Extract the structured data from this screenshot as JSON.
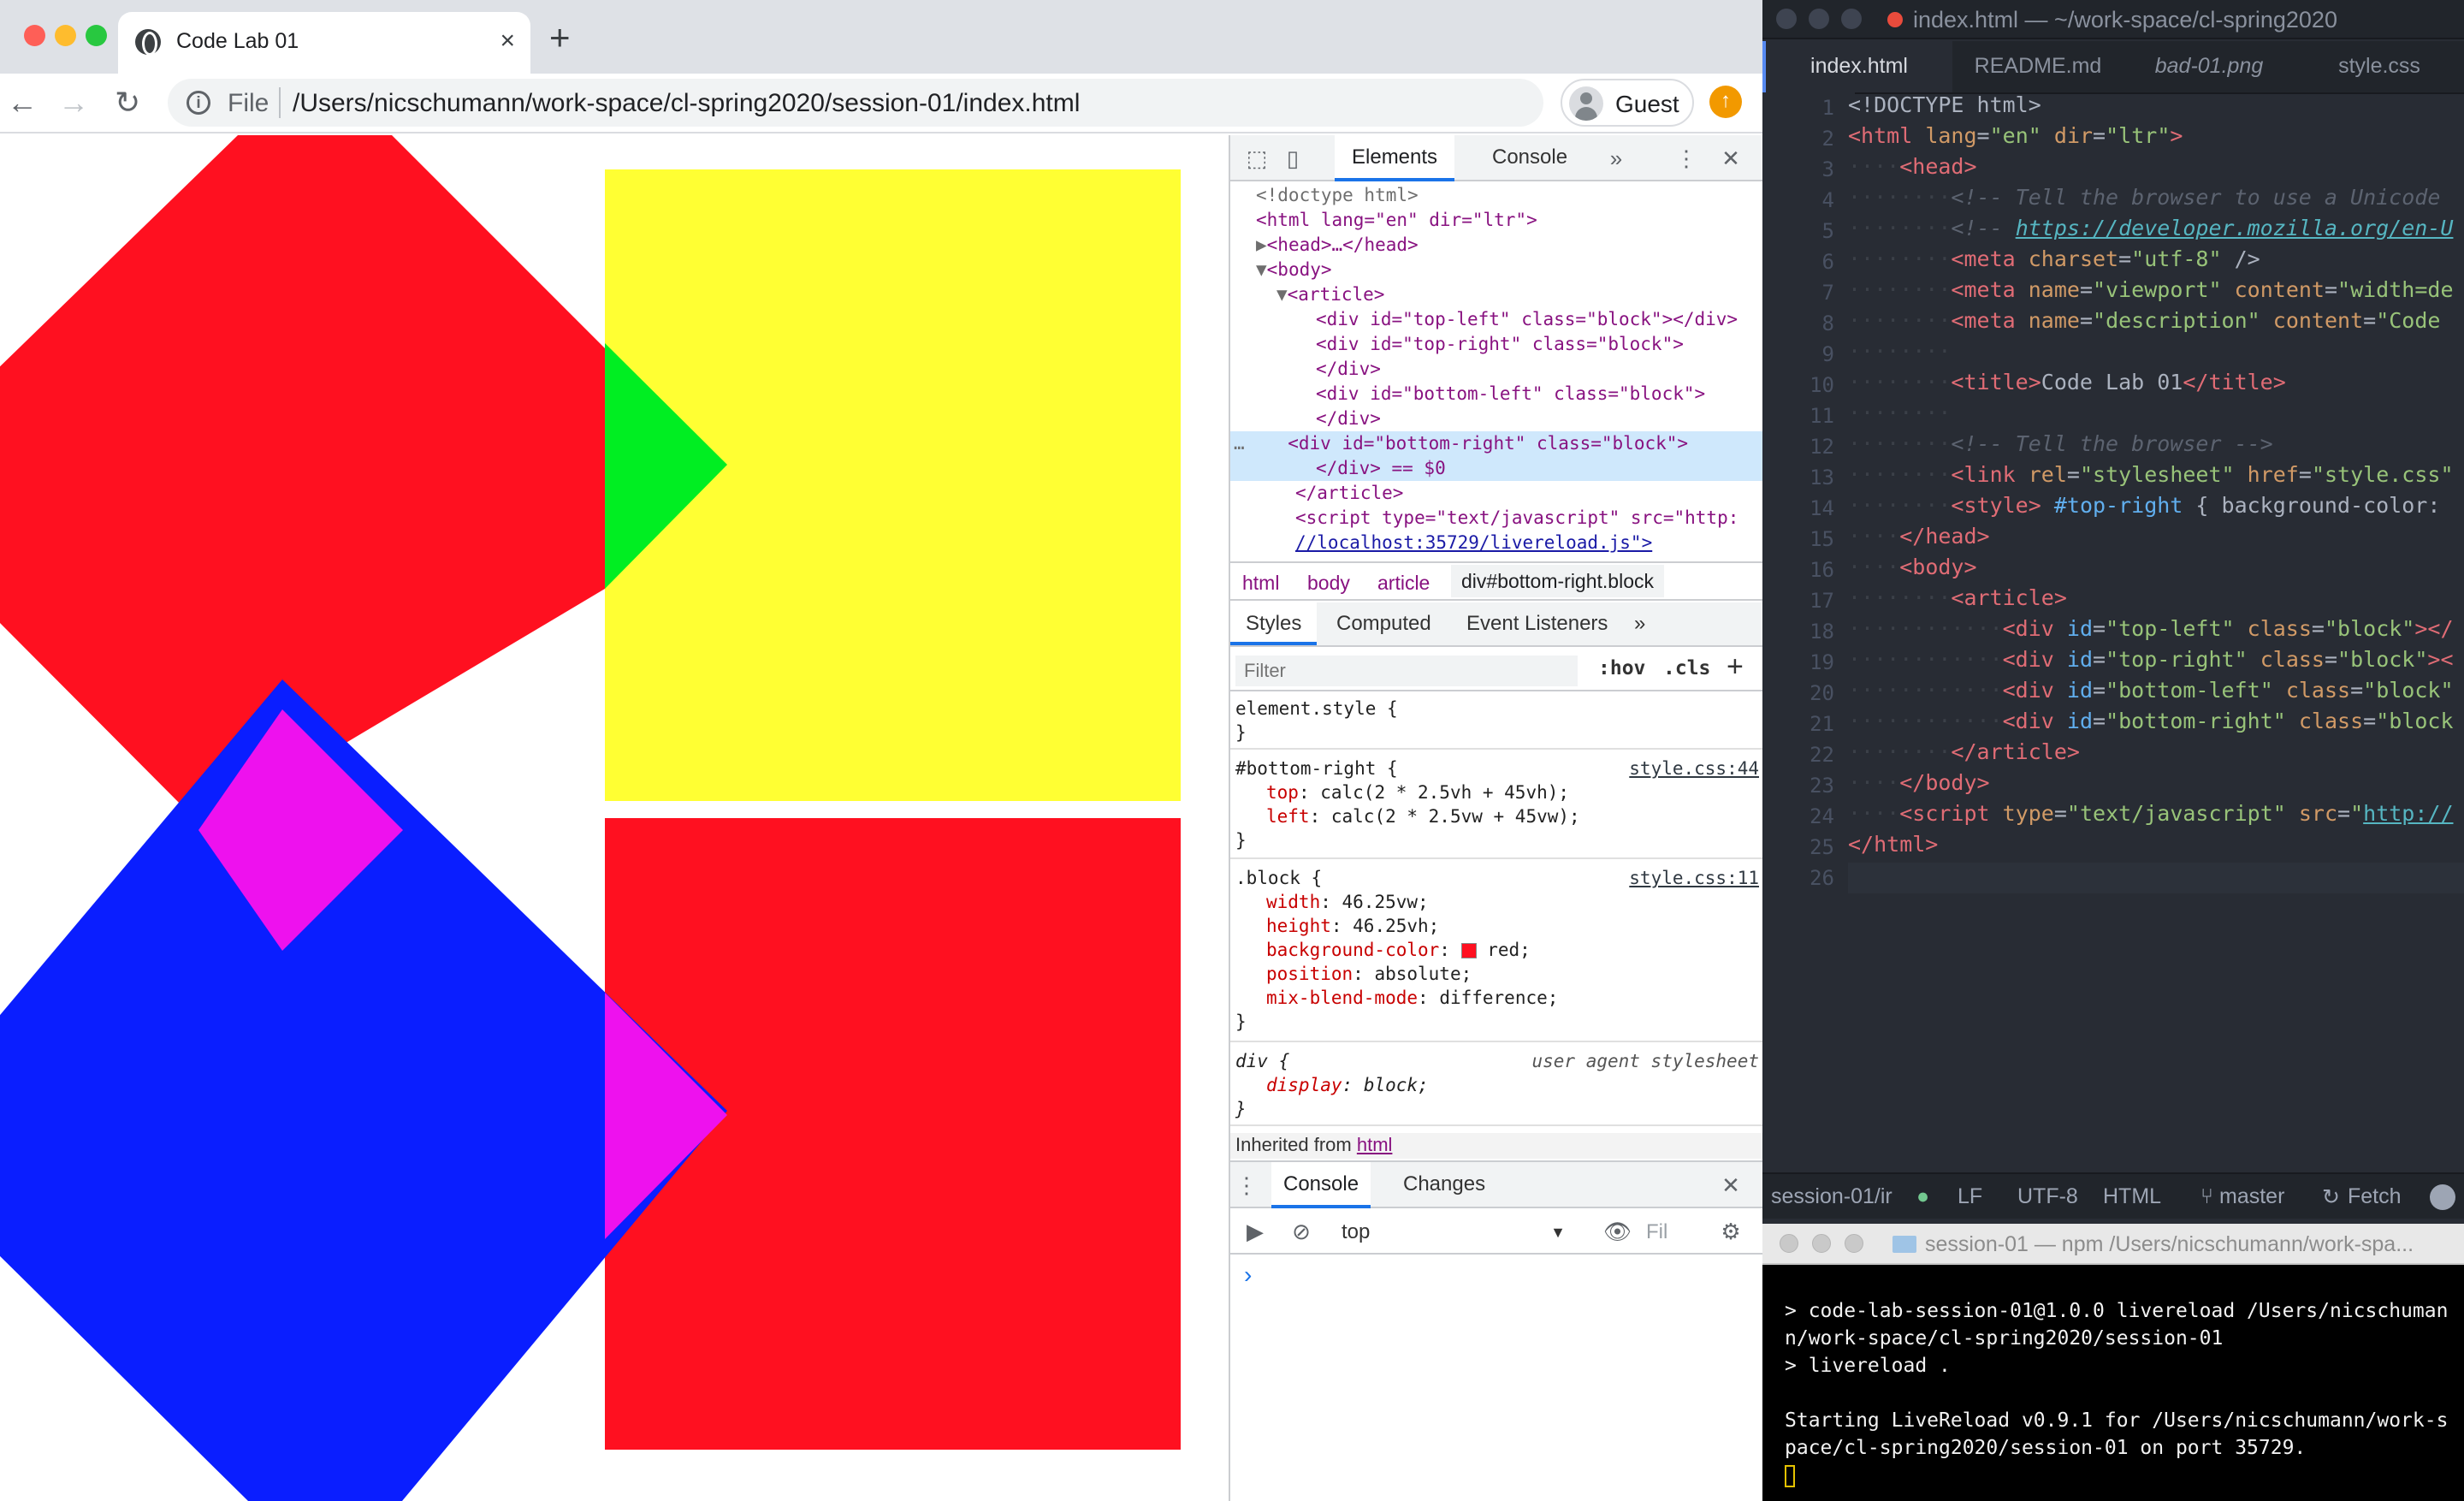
{
  "browser": {
    "tab_title": "Code Lab 01",
    "tab_close": "×",
    "new_tab": "+",
    "back": "←",
    "forward": "→",
    "reload": "↻",
    "info": "i",
    "scheme_label": "File",
    "url": "/Users/nicschumann/work-space/cl-spring2020/session-01/index.html",
    "profile_name": "Guest",
    "update_icon": "↑"
  },
  "page": {
    "colors": {
      "red": "#ff1020",
      "yellow": "#ffff33",
      "blue": "#0a1eff",
      "green": "#00ee22",
      "magenta": "#ee11ee"
    }
  },
  "devtools": {
    "tabs": [
      "Elements",
      "Console"
    ],
    "more": "»",
    "menu": "⋮",
    "close": "✕",
    "dom_lines": [
      "<!doctype html>",
      "<html lang=\"en\" dir=\"ltr\">",
      "<head>…</head>",
      "<body>",
      "<article>",
      "<div id=\"top-left\" class=\"block\"></div>",
      "<div id=\"top-right\" class=\"block\">",
      "</div>",
      "<div id=\"bottom-left\" class=\"block\">",
      "</div>",
      "<div id=\"bottom-right\" class=\"block\">",
      "</div> == $0",
      "</article>",
      "<script type=\"text/javascript\" src=\"http:",
      "//localhost:35729/livereload.js\">"
    ],
    "dom_marker": "…",
    "breadcrumbs": [
      "html",
      "body",
      "article",
      "div#bottom-right.block"
    ],
    "sub_tabs": [
      "Styles",
      "Computed",
      "Event Listeners"
    ],
    "filter_placeholder": "Filter",
    "hov": ":hov",
    "cls": ".cls",
    "add": "+",
    "element_style": "element.style {",
    "close_brace": "}",
    "rule1": {
      "selector": "#bottom-right",
      "source": "style.css:44",
      "props": [
        [
          "top",
          "calc(2 * 2.5vh + 45vh);"
        ],
        [
          "left",
          "calc(2 * 2.5vw + 45vw);"
        ]
      ]
    },
    "rule2": {
      "selector": ".block",
      "source": "style.css:11",
      "props": [
        [
          "width",
          "46.25vw;"
        ],
        [
          "height",
          "46.25vh;"
        ],
        [
          "background-color",
          "red;"
        ],
        [
          "position",
          "absolute;"
        ],
        [
          "mix-blend-mode",
          "difference;"
        ]
      ]
    },
    "rule3": {
      "selector": "div",
      "source": "user agent stylesheet",
      "props": [
        [
          "display",
          "block;"
        ]
      ]
    },
    "inherited": "Inherited from",
    "inherited_el": "html",
    "drawer_tabs": [
      "Console",
      "Changes"
    ],
    "context": "top",
    "filter_short": "Fil",
    "prompt": "›"
  },
  "editor": {
    "window_title": "index.html — ~/work-space/cl-spring2020",
    "tabs": [
      "index.html",
      "README.md",
      "bad-01.png",
      "style.css"
    ],
    "status": {
      "path": "session-01/ir",
      "line_ending": "LF",
      "encoding": "UTF-8",
      "grammar": "HTML",
      "branch": "master",
      "fetch": "Fetch"
    },
    "line_numbers": [
      "1",
      "2",
      "3",
      "4",
      "5",
      "6",
      "7",
      "8",
      "9",
      "10",
      "11",
      "12",
      "13",
      "14",
      "15",
      "16",
      "17",
      "18",
      "19",
      "20",
      "21",
      "22",
      "23",
      "24",
      "25",
      "26"
    ],
    "code": {
      "doctype": "<!DOCTYPE html>",
      "l4": "<!-- Tell the browser to use a Unicode",
      "l5_open": "<!-- ",
      "l5_url": "https://developer.mozilla.org/en-U",
      "l10_title": "Code Lab 01",
      "l12": "<!-- Tell the browser -->",
      "l13_href": "\"style.css\"",
      "l14_sel": "#top-right",
      "l14_rest": " { background-color:",
      "l24_src": "http://"
    }
  },
  "terminal": {
    "title": "session-01 — npm /Users/nicschumann/work-spa...",
    "lines": [
      "> code-lab-session-01@1.0.0 livereload /Users/nicschuman",
      "n/work-space/cl-spring2020/session-01",
      "> livereload .",
      "",
      "Starting LiveReload v0.9.1 for /Users/nicschumann/work-s",
      "pace/cl-spring2020/session-01 on port 35729."
    ]
  }
}
